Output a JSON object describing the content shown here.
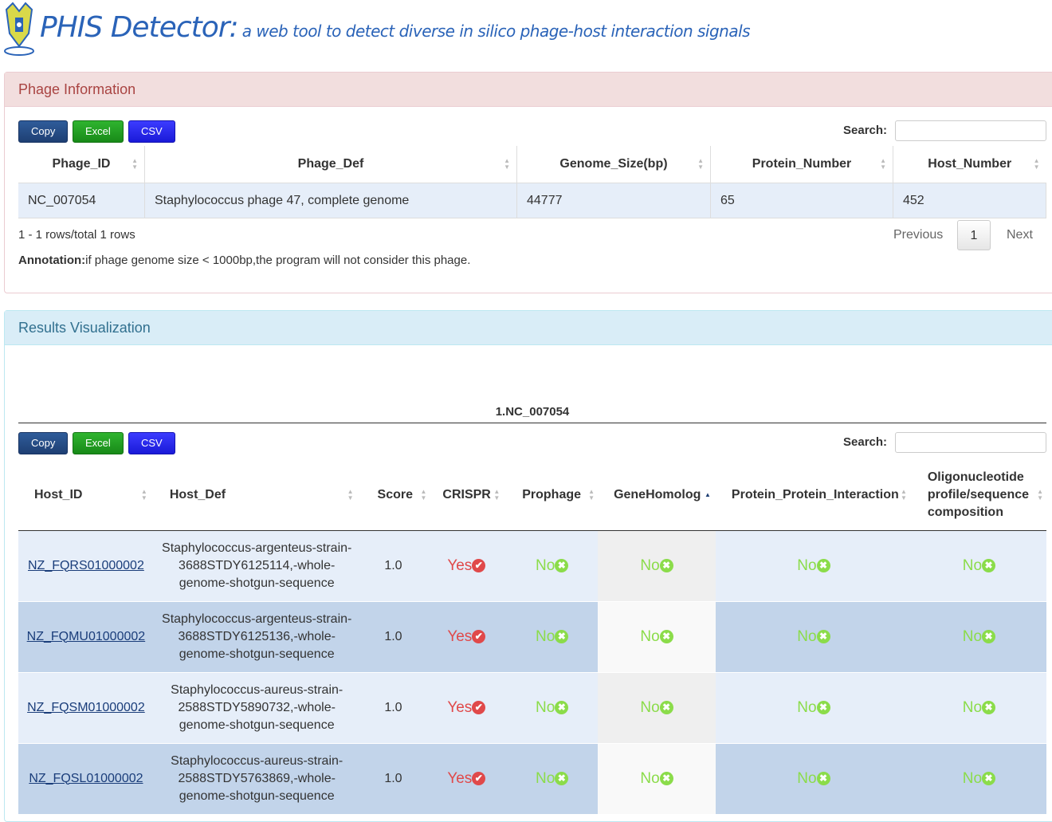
{
  "header": {
    "title": "PHIS Detector:",
    "subtitle": "a web tool to detect diverse in silico phage-host interaction signals"
  },
  "phage_panel": {
    "heading": "Phage Information",
    "buttons": {
      "copy": "Copy",
      "excel": "Excel",
      "csv": "CSV"
    },
    "search_label": "Search:",
    "columns": [
      "Phage_ID",
      "Phage_Def",
      "Genome_Size(bp)",
      "Protein_Number",
      "Host_Number"
    ],
    "rows": [
      [
        "NC_007054",
        "Staphylococcus phage 47, complete genome",
        "44777",
        "65",
        "452"
      ]
    ],
    "info": "1 - 1 rows/total 1 rows",
    "pager": {
      "previous": "Previous",
      "current": "1",
      "next": "Next"
    },
    "annotation_label": "Annotation:",
    "annotation_text": "if phage genome size < 1000bp,the program will not consider this phage."
  },
  "results_panel": {
    "heading": "Results Visualization",
    "section_title": "1.NC_007054",
    "buttons": {
      "copy": "Copy",
      "excel": "Excel",
      "csv": "CSV"
    },
    "search_label": "Search:",
    "columns": [
      "Host_ID",
      "Host_Def",
      "Score",
      "CRISPR",
      "Prophage",
      "GeneHomolog",
      "Protein_Protein_Interaction",
      "Oligonucleotide profile/sequence composition"
    ],
    "rows": [
      {
        "id": "NZ_FQRS01000002",
        "def": "Staphylococcus-argenteus-strain-3688STDY6125114,-whole-genome-shotgun-sequence",
        "score": "1.0",
        "crispr": "Yes",
        "prophage": "No",
        "genehomolog": "No",
        "ppi": "No",
        "oligo": "No"
      },
      {
        "id": "NZ_FQMU01000002",
        "def": "Staphylococcus-argenteus-strain-3688STDY6125136,-whole-genome-shotgun-sequence",
        "score": "1.0",
        "crispr": "Yes",
        "prophage": "No",
        "genehomolog": "No",
        "ppi": "No",
        "oligo": "No"
      },
      {
        "id": "NZ_FQSM01000002",
        "def": "Staphylococcus-aureus-strain-2588STDY5890732,-whole-genome-shotgun-sequence",
        "score": "1.0",
        "crispr": "Yes",
        "prophage": "No",
        "genehomolog": "No",
        "ppi": "No",
        "oligo": "No"
      },
      {
        "id": "NZ_FQSL01000002",
        "def": "Staphylococcus-aureus-strain-2588STDY5763869,-whole-genome-shotgun-sequence",
        "score": "1.0",
        "crispr": "Yes",
        "prophage": "No",
        "genehomolog": "No",
        "ppi": "No",
        "oligo": "No"
      }
    ]
  },
  "colors": {
    "yes": "#e0494a",
    "no": "#8bdc4a",
    "link": "#1a3d7a"
  }
}
